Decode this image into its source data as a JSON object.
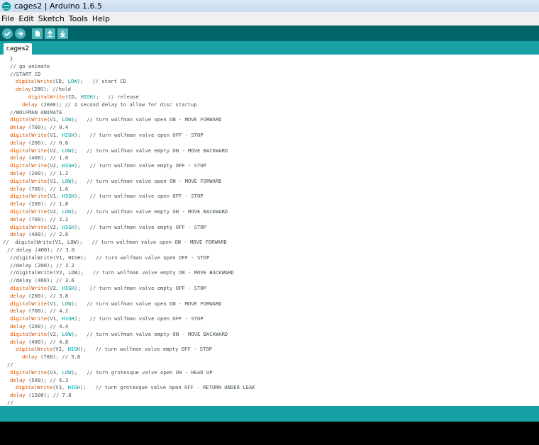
{
  "window": {
    "title": "cages2 | Arduino 1.6.5"
  },
  "menu": [
    "File",
    "Edit",
    "Sketch",
    "Tools",
    "Help"
  ],
  "toolbar": {
    "buttons": [
      {
        "name": "verify-button",
        "icon": "check-icon",
        "shape": "round"
      },
      {
        "name": "upload-button",
        "icon": "arrow-right-icon",
        "shape": "round"
      },
      {
        "name": "new-button",
        "icon": "document-icon",
        "shape": "square"
      },
      {
        "name": "open-button",
        "icon": "arrow-up-icon",
        "shape": "square"
      },
      {
        "name": "save-button",
        "icon": "arrow-down-icon",
        "shape": "square"
      }
    ]
  },
  "tabs": [
    {
      "label": "cages2"
    }
  ],
  "colors": {
    "toolbar": "#006468",
    "tabbar": "#17a1a5",
    "function": "#d35400",
    "keyword": "#00979c",
    "text": "#434f54"
  },
  "code": {
    "lines": [
      {
        "indent": 14,
        "text": "}"
      },
      {
        "indent": 14,
        "text": "// go animate"
      },
      {
        "indent": 14,
        "text": "//START CD"
      },
      {
        "indent": 22,
        "text": "digitalWrite(CD, LOW);   // start CD"
      },
      {
        "indent": 22,
        "text": "delay(200); //hold"
      },
      {
        "indent": 40,
        "text": "digitalWrite(CD, HIGH);   // release"
      },
      {
        "indent": 31,
        "text": "delay (2000); // 2 second delay to allow for disc startup"
      },
      {
        "indent": 14,
        "text": "//WOLFMAN ANIMATE"
      },
      {
        "indent": 14,
        "text": "digitalWrite(V1, LOW);   // turn wolfman valve open ON - MOVE FORWARD"
      },
      {
        "indent": 14,
        "text": "delay (700); // 0.4"
      },
      {
        "indent": 14,
        "text": "digitalWrite(V1, HIGH);   // turn wolfman valve open OFF - STOP"
      },
      {
        "indent": 14,
        "text": "delay (200); // 0.6"
      },
      {
        "indent": 14,
        "text": "digitalWrite(V2, LOW);   // turn wolfman valve empty ON - MOVE BACKWARD"
      },
      {
        "indent": 14,
        "text": "delay (400); // 1.0"
      },
      {
        "indent": 14,
        "text": "digitalWrite(V2, HIGH);   // turn wolfman valve empty OFF - STOP"
      },
      {
        "indent": 14,
        "text": "delay (200); // 1.2"
      },
      {
        "indent": 14,
        "text": "digitalWrite(V1, LOW);   // turn wolfman valve open ON - MOVE FORWARD"
      },
      {
        "indent": 14,
        "text": "delay (700); // 1.6"
      },
      {
        "indent": 14,
        "text": "digitalWrite(V1, HIGH);   // turn wolfman valve open OFF - STOP"
      },
      {
        "indent": 14,
        "text": "delay (200); // 1.8"
      },
      {
        "indent": 14,
        "text": "digitalWrite(V2, LOW);   // turn wolfman valve empty ON - MOVE BACKWARD"
      },
      {
        "indent": 14,
        "text": "delay (700); // 2.2"
      },
      {
        "indent": 14,
        "text": "digitalWrite(V2, HIGH);   // turn wolfman valve empty OFF - STOP"
      },
      {
        "indent": 14,
        "text": "delay (400); // 2.6"
      },
      {
        "indent": 4,
        "text": "//  digitalWrite(V1, LOW);   // turn wolfman valve open ON - MOVE FORWARD"
      },
      {
        "indent": 10,
        "text": "// delay (400); // 3.0"
      },
      {
        "indent": 14,
        "text": "//digitalWrite(V1, HIGH);   // turn wolfman valve open OFF - STOP"
      },
      {
        "indent": 14,
        "text": "//delay (200); // 3.2"
      },
      {
        "indent": 14,
        "text": "//digitalWrite(V2, LOW);   // turn wolfman valve empty ON - MOVE BACKWARD"
      },
      {
        "indent": 14,
        "text": "//delay (400); // 3.6"
      },
      {
        "indent": 14,
        "text": "digitalWrite(V2, HIGH);   // turn wolfman valve empty OFF - STOP"
      },
      {
        "indent": 14,
        "text": "delay (200); // 3.8"
      },
      {
        "indent": 14,
        "text": "digitalWrite(V1, LOW);   // turn wolfman valve open ON - MOVE FORWARD"
      },
      {
        "indent": 14,
        "text": "delay (700); // 4.2"
      },
      {
        "indent": 14,
        "text": "digitalWrite(V1, HIGH);   // turn wolfman valve open OFF - STOP"
      },
      {
        "indent": 14,
        "text": "delay (200); // 4.4"
      },
      {
        "indent": 14,
        "text": "digitalWrite(V2, LOW);   // turn wolfman valve empty ON - MOVE BACKWARD"
      },
      {
        "indent": 14,
        "text": "delay (400); // 4.8"
      },
      {
        "indent": 22,
        "text": "digitalWrite(V2, HIGH);   // turn wolfman valve empty OFF - STOP"
      },
      {
        "indent": 31,
        "text": "delay (700); // 5.8"
      },
      {
        "indent": 10,
        "text": "//"
      },
      {
        "indent": 14,
        "text": "digitalWrite(V3, LOW);   // turn grotesque valve open ON - HEAD UP"
      },
      {
        "indent": 14,
        "text": "delay (500); // 6.3"
      },
      {
        "indent": 22,
        "text": "digitalWrite(V3, HIGH);   // turn grotesque valve open OFF - RETURN UNDER LEAK"
      },
      {
        "indent": 14,
        "text": "delay (1500); // 7.8"
      },
      {
        "indent": 10,
        "text": "//"
      }
    ]
  }
}
